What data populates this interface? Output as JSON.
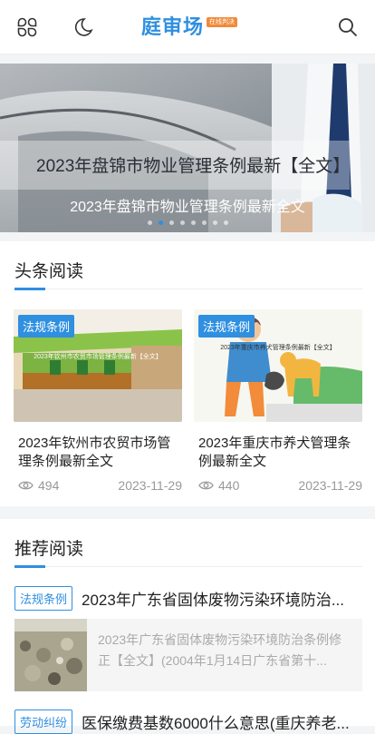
{
  "header": {
    "logo_text": "庭审场",
    "logo_badge": "在线判决",
    "icons": [
      "menu-grid-icon",
      "moon-icon",
      "search-icon"
    ],
    "accent": "#2f8fe0"
  },
  "banner": {
    "title": "2023年盘锦市物业管理条例最新【全文】",
    "caption": "2023年盘锦市物业管理条例最新全文",
    "slide_count": 8,
    "active_slide": 2
  },
  "headlines": {
    "section_title": "头条阅读",
    "items": [
      {
        "tag": "法规条例",
        "image_caption": "2023年钦州市农贸市场管理条例最新【全文】",
        "title": "2023年钦州市农贸市场管理条例最新全文",
        "views": "494",
        "date": "2023-11-29"
      },
      {
        "tag": "法规条例",
        "image_caption": "2023年重庆市养犬管理条例最新【全文】",
        "title": "2023年重庆市养犬管理条例最新全文",
        "views": "440",
        "date": "2023-11-29"
      }
    ]
  },
  "recommended": {
    "section_title": "推荐阅读",
    "items": [
      {
        "tag": "法规条例",
        "title": "2023年广东省固体废物污染环境防治...",
        "summary": "2023年广东省固体废物污染环境防治条例修正【全文】(2004年1月14日广东省第十..."
      },
      {
        "tag": "劳动纠纷",
        "title": "医保缴费基数6000什么意思(重庆养老..."
      }
    ]
  }
}
